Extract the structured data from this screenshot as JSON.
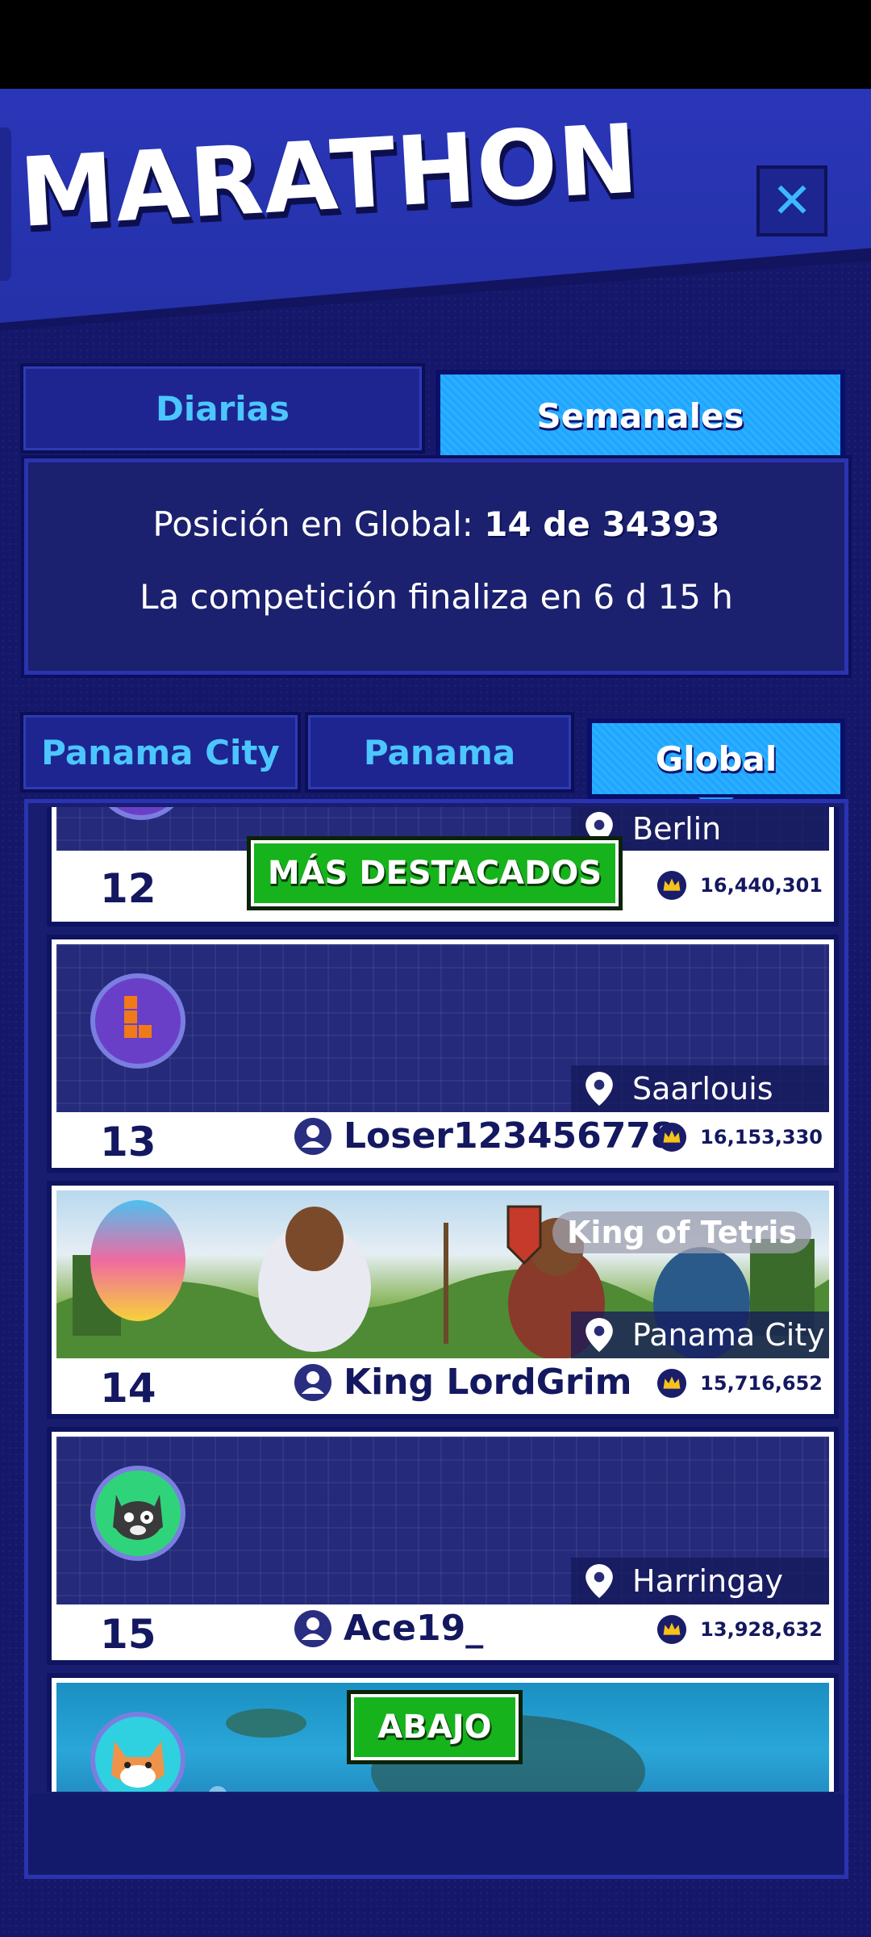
{
  "header": {
    "title": "MARATHON",
    "close_label": "✕"
  },
  "period_tabs": [
    {
      "label": "Diarias",
      "selected": false
    },
    {
      "label": "Semanales",
      "selected": true
    }
  ],
  "info": {
    "position_prefix": "Posición en Global:",
    "position_value": "14 de 34393",
    "ends_text": "La competición finaliza en 6 d 15 h"
  },
  "region_tabs": [
    {
      "label": "Panama City",
      "selected": false
    },
    {
      "label": "Panama",
      "selected": false
    },
    {
      "label": "Global",
      "selected": true
    }
  ],
  "buttons": {
    "highlights": "MÁS DESTACADOS",
    "down": "ABAJO"
  },
  "entries": [
    {
      "rank": "12",
      "player": "",
      "location": "Berlin",
      "score": "16,440,301"
    },
    {
      "rank": "13",
      "player": "Loser123456778",
      "location": "Saarlouis",
      "score": "16,153,330"
    },
    {
      "rank": "14",
      "player": "King LordGrim",
      "location": "Panama City",
      "score": "15,716,652",
      "title_tag": "King of Tetris"
    },
    {
      "rank": "15",
      "player": "Ace19_",
      "location": "Harringay",
      "score": "13,928,632"
    }
  ],
  "colors": {
    "accent_blue": "#1ea7ff",
    "text_cyan": "#4cc6ff",
    "bg_navy": "#15186a",
    "green": "#16b31c"
  }
}
